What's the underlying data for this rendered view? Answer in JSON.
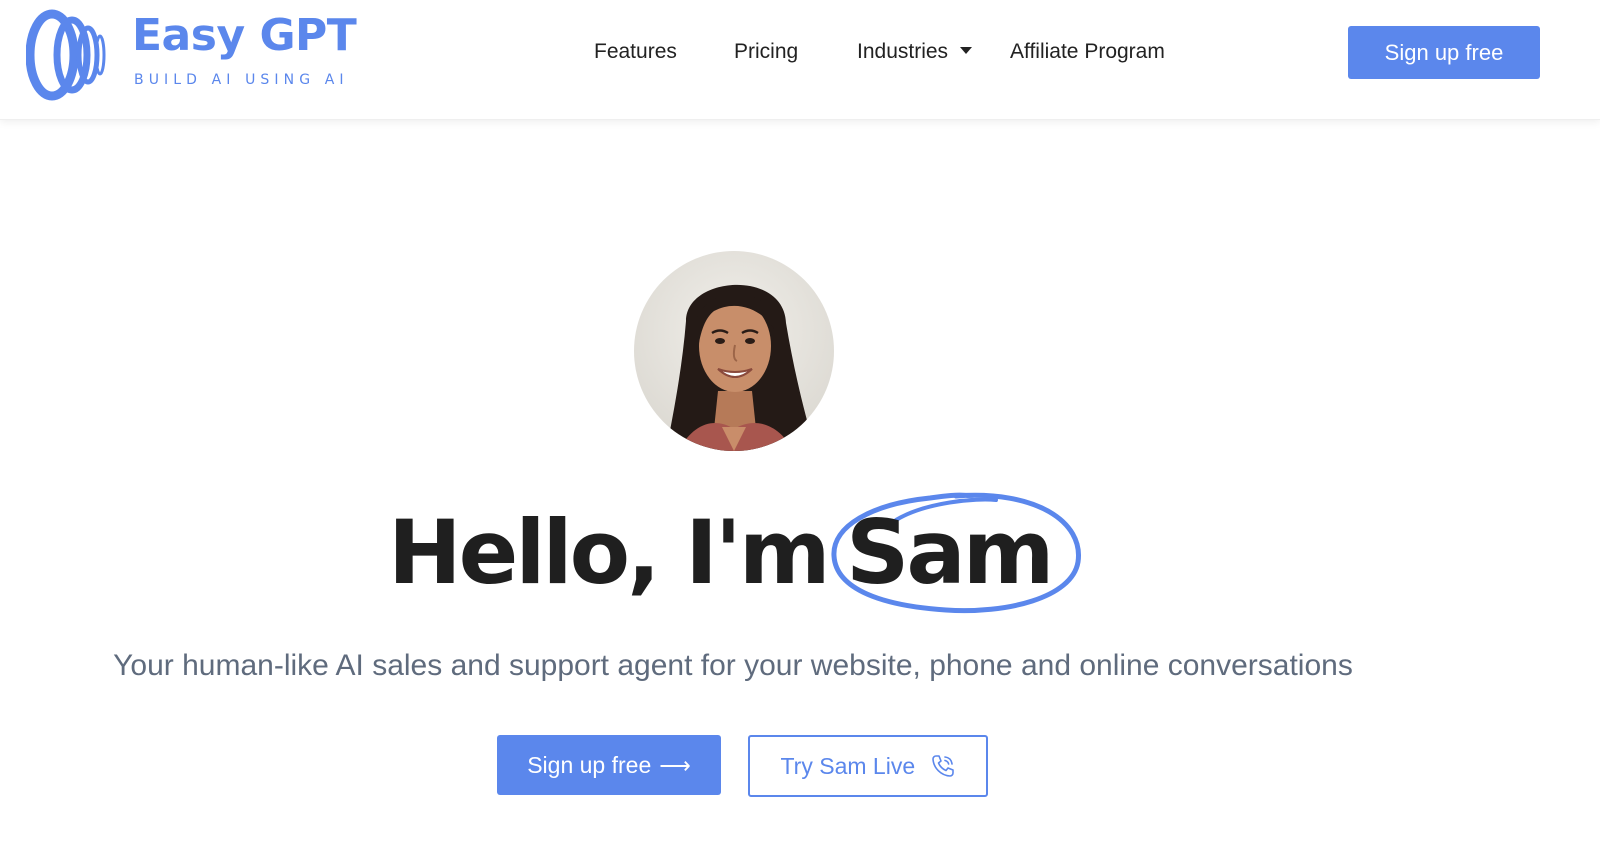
{
  "brand": {
    "name": "Easy GPT",
    "tagline": "BUILD AI USING AI",
    "color": "#5b87ec",
    "logo_icon": "concentric-arcs-logo-icon"
  },
  "nav": {
    "items": [
      {
        "label": "Features"
      },
      {
        "label": "Pricing"
      },
      {
        "label": "Industries",
        "has_dropdown": true,
        "icon": "caret-down-icon"
      },
      {
        "label": "Affiliate Program"
      }
    ],
    "cta_label": "Sign up free"
  },
  "hero": {
    "avatar_alt": "avatar",
    "headline_prefix": "Hello, I'm",
    "headline_name": "Sam",
    "subtitle": "Your human-like AI sales and support agent for your website, phone and online conversations",
    "primary_cta": {
      "label": "Sign up free",
      "icon": "arrow-right-icon"
    },
    "secondary_cta": {
      "label": "Try Sam Live",
      "icon": "phone-ringing-icon"
    }
  },
  "colors": {
    "accent": "#5b87ec",
    "text_dark": "#1f1f1f",
    "text_muted": "#5f6b7d"
  }
}
